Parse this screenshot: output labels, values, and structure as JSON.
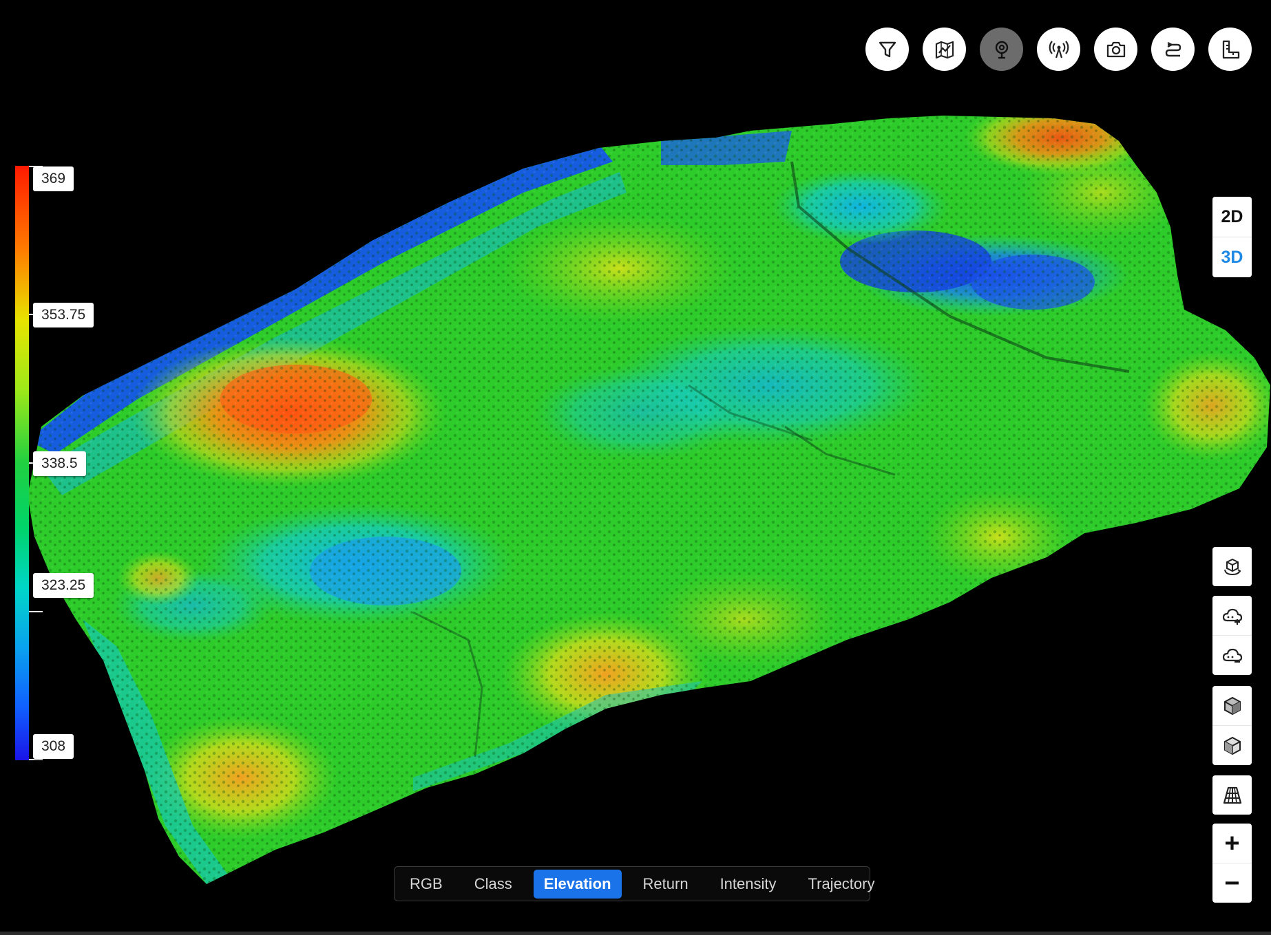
{
  "legend": {
    "title": "",
    "max_label": "369",
    "upper_label": "353.75",
    "mid_label": "338.5",
    "lower_label": "323.25",
    "min_label": "308",
    "colors": [
      "#ff1a00",
      "#ff7b00",
      "#e7e400",
      "#9be81a",
      "#20d040",
      "#00d46a",
      "#00d6c8",
      "#0aa2ee",
      "#1060ff",
      "#1a14e6"
    ]
  },
  "top_toolbar": {
    "buttons": [
      {
        "id": "filter",
        "icon": "filter-icon",
        "active": false
      },
      {
        "id": "chart",
        "icon": "map-chart-icon",
        "active": false
      },
      {
        "id": "location",
        "icon": "location-pin-icon",
        "active": true
      },
      {
        "id": "antenna",
        "icon": "antenna-icon",
        "active": false
      },
      {
        "id": "camera",
        "icon": "camera-icon",
        "active": false
      },
      {
        "id": "path",
        "icon": "route-icon",
        "active": false
      },
      {
        "id": "measure",
        "icon": "measure-icon",
        "active": false
      }
    ]
  },
  "view_mode": {
    "options": [
      "2D",
      "3D"
    ],
    "selected": "3D"
  },
  "side_tools": {
    "rotate": {
      "icon": "rotate-cube-icon"
    },
    "cloud_add": {
      "icon": "cloud-add-icon"
    },
    "cloud_remove": {
      "icon": "cloud-remove-icon"
    },
    "cube_top": {
      "icon": "cube-solid-icon"
    },
    "cube_bottom": {
      "icon": "cube-outline-icon"
    },
    "grid": {
      "icon": "perspective-grid-icon"
    },
    "zoom_in_label": "+",
    "zoom_out_label": "−"
  },
  "color_modes": {
    "tabs": [
      "RGB",
      "Class",
      "Elevation",
      "Return",
      "Intensity",
      "Trajectory"
    ],
    "selected": "Elevation"
  }
}
